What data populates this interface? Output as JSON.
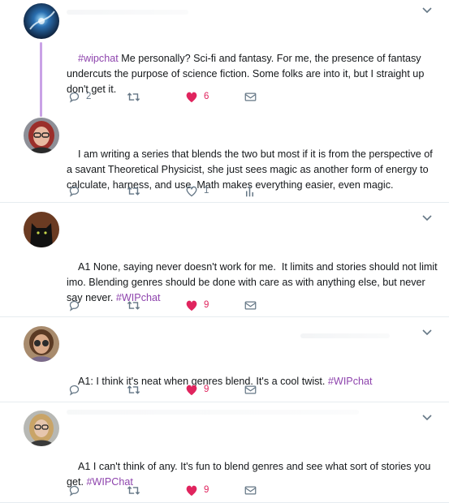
{
  "tweets": [
    {
      "avatar": "avatar-galaxy",
      "segments": [
        {
          "text": "#wipchat",
          "hashtag": true
        },
        {
          "text": " Me personally? Sci-fi and fantasy. For me, the presence of fantasy undercuts the purpose of science fiction. Some folks are into it, but I straight up don't get it.",
          "hashtag": false
        }
      ],
      "reply_count": "2",
      "like_count": "6",
      "liked": true,
      "has_analytics": false
    },
    {
      "avatar": "avatar-red-hair",
      "segments": [
        {
          "text": "I am writing a series that blends the two but most if it is from the perspective of a savant Theoretical Physicist, she just sees magic as another form of energy to calculate, harness, and use. Math makes everything easier, even magic.",
          "hashtag": false
        }
      ],
      "reply_count": "",
      "like_count": "1",
      "liked": false,
      "has_analytics": true
    },
    {
      "avatar": "avatar-black-cat",
      "segments": [
        {
          "text": "A1 None, saying never doesn't work for me.  It limits and stories should not limit imo. Blending genres should be done with care as with anything else, but never say never. ",
          "hashtag": false
        },
        {
          "text": "#WIPchat",
          "hashtag": true
        }
      ],
      "reply_count": "",
      "like_count": "9",
      "liked": true,
      "has_analytics": false
    },
    {
      "avatar": "avatar-glasses-woman",
      "segments": [
        {
          "text": "A1: I think it's neat when genres blend. It's a cool twist. ",
          "hashtag": false
        },
        {
          "text": "#WIPchat",
          "hashtag": true
        }
      ],
      "reply_count": "",
      "like_count": "9",
      "liked": true,
      "has_analytics": false
    },
    {
      "avatar": "avatar-blonde-woman",
      "segments": [
        {
          "text": "A1 I can't think of any. It's fun to blend genres and see what sort of stories you get. ",
          "hashtag": false
        },
        {
          "text": "#WIPChat",
          "hashtag": true
        }
      ],
      "reply_count": "",
      "like_count": "9",
      "liked": true,
      "has_analytics": false
    }
  ],
  "icons": {
    "reply": "reply-icon",
    "retweet": "retweet-icon",
    "like": "heart-icon",
    "message": "envelope-icon",
    "analytics": "analytics-icon",
    "menu": "chevron-down-icon"
  },
  "colors": {
    "like": "#e0245e",
    "hashtag": "#8e44ad",
    "icon": "#657786",
    "thread_line": "#c9a2e6"
  }
}
